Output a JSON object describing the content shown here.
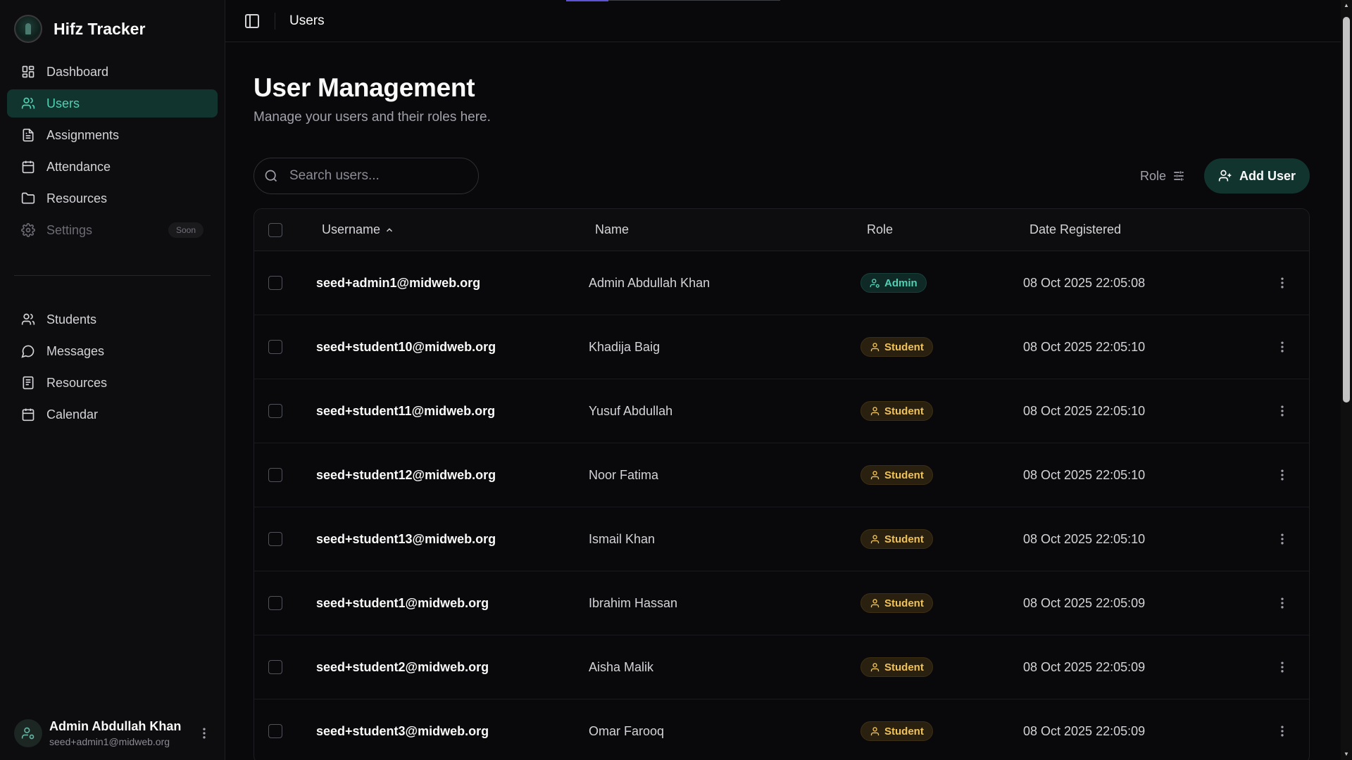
{
  "app": {
    "name": "Hifz Tracker"
  },
  "sidebar": {
    "primary": [
      {
        "label": "Dashboard"
      },
      {
        "label": "Users"
      },
      {
        "label": "Assignments"
      },
      {
        "label": "Attendance"
      },
      {
        "label": "Resources"
      },
      {
        "label": "Settings",
        "badge": "Soon"
      }
    ],
    "secondary": [
      {
        "label": "Students"
      },
      {
        "label": "Messages"
      },
      {
        "label": "Resources"
      },
      {
        "label": "Calendar"
      }
    ],
    "user": {
      "name": "Admin Abdullah Khan",
      "email": "seed+admin1@midweb.org"
    }
  },
  "topbar": {
    "breadcrumb": "Users"
  },
  "page": {
    "title": "User Management",
    "subtitle": "Manage your users and their roles here.",
    "search_placeholder": "Search users...",
    "role_filter_label": "Role",
    "add_user_label": "Add User"
  },
  "table": {
    "columns": {
      "username": "Username",
      "name": "Name",
      "role": "Role",
      "date": "Date Registered"
    },
    "rows": [
      {
        "username": "seed+admin1@midweb.org",
        "name": "Admin Abdullah Khan",
        "role": "Admin",
        "date": "08 Oct 2025 22:05:08"
      },
      {
        "username": "seed+student10@midweb.org",
        "name": "Khadija Baig",
        "role": "Student",
        "date": "08 Oct 2025 22:05:10"
      },
      {
        "username": "seed+student11@midweb.org",
        "name": "Yusuf Abdullah",
        "role": "Student",
        "date": "08 Oct 2025 22:05:10"
      },
      {
        "username": "seed+student12@midweb.org",
        "name": "Noor Fatima",
        "role": "Student",
        "date": "08 Oct 2025 22:05:10"
      },
      {
        "username": "seed+student13@midweb.org",
        "name": "Ismail Khan",
        "role": "Student",
        "date": "08 Oct 2025 22:05:10"
      },
      {
        "username": "seed+student1@midweb.org",
        "name": "Ibrahim Hassan",
        "role": "Student",
        "date": "08 Oct 2025 22:05:09"
      },
      {
        "username": "seed+student2@midweb.org",
        "name": "Aisha Malik",
        "role": "Student",
        "date": "08 Oct 2025 22:05:09"
      },
      {
        "username": "seed+student3@midweb.org",
        "name": "Omar Farooq",
        "role": "Student",
        "date": "08 Oct 2025 22:05:09"
      }
    ]
  },
  "colors": {
    "accent": "#4fd1b4",
    "active_bg": "#12342e",
    "student_badge": "#f0c35a",
    "background": "#09090b"
  }
}
